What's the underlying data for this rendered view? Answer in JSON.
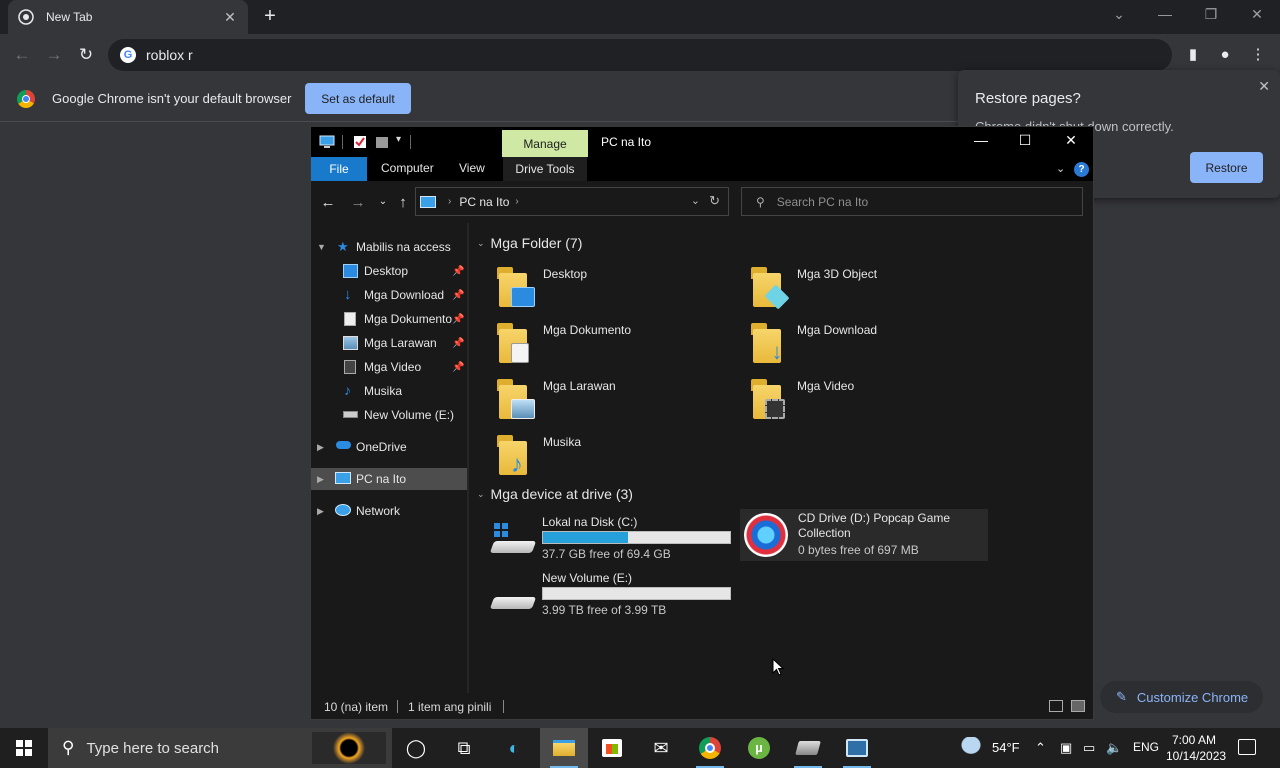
{
  "chrome": {
    "tab_title": "New Tab",
    "omnibox_text": "roblox r",
    "infobar_message": "Google Chrome isn't your default browser",
    "set_default_label": "Set as default",
    "restore_title": "Restore pages?",
    "restore_subtitle": "Chrome didn't shut down correctly.",
    "restore_button": "Restore",
    "customize_label": "Customize Chrome"
  },
  "explorer": {
    "title": "PC na Ito",
    "manage_tab": "Manage",
    "ribbon_tabs": [
      "File",
      "Computer",
      "View",
      "Drive Tools"
    ],
    "address_path": "PC na Ito",
    "search_placeholder": "Search PC na Ito",
    "nav": {
      "quick_access": "Mabilis na access",
      "items": [
        {
          "label": "Desktop",
          "pinned": true
        },
        {
          "label": "Mga Download",
          "pinned": true
        },
        {
          "label": "Mga Dokumento",
          "pinned": true
        },
        {
          "label": "Mga Larawan",
          "pinned": true
        },
        {
          "label": "Mga Video",
          "pinned": true
        },
        {
          "label": "Musika",
          "pinned": false
        },
        {
          "label": "New Volume (E:)",
          "pinned": false
        }
      ],
      "onedrive": "OneDrive",
      "this_pc": "PC na Ito",
      "network": "Network"
    },
    "folders_header": "Mga Folder (7)",
    "folders": [
      {
        "label": "Desktop"
      },
      {
        "label": "Mga 3D Object"
      },
      {
        "label": "Mga Dokumento"
      },
      {
        "label": "Mga Download"
      },
      {
        "label": "Mga Larawan"
      },
      {
        "label": "Mga Video"
      },
      {
        "label": "Musika"
      }
    ],
    "devices_header": "Mga device at drive (3)",
    "drives": [
      {
        "name": "Lokal na Disk (C:)",
        "free": "37.7 GB free of 69.4 GB",
        "used_fraction": 0.457
      },
      {
        "name": "CD Drive (D:) Popcap Game Collection",
        "free": "0 bytes free of 697 MB"
      },
      {
        "name": "New Volume (E:)",
        "free": "3.99 TB free of 3.99 TB",
        "used_fraction": 0.0
      }
    ],
    "status_items": "10 (na) item",
    "status_selected": "1 item ang pinili"
  },
  "taskbar": {
    "search_placeholder": "Type here to search",
    "weather": "54°F",
    "language": "ENG",
    "time": "7:00 AM",
    "date": "10/14/2023"
  }
}
